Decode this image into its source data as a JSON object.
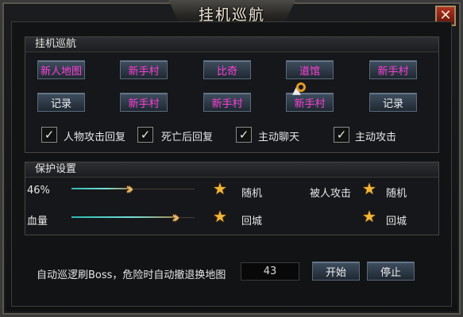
{
  "window": {
    "title": "挂机巡航",
    "close_glyph": "✕"
  },
  "patrol": {
    "title": "挂机巡航",
    "row1": [
      "新人地图",
      "新手村",
      "比奇",
      "道馆",
      "新手村"
    ],
    "row2": [
      "记录",
      "新手村",
      "新手村",
      "新手村",
      "记录"
    ],
    "checkboxes": [
      "人物攻击回复",
      "死亡后回复",
      "主动聊天",
      "主动攻击"
    ]
  },
  "protect": {
    "title": "保护设置",
    "hp_percent_label": "46%",
    "hp_percent_value": 46,
    "hp_label": "血量",
    "option1": "随机",
    "attacked_label": "被人攻击",
    "option2": "随机",
    "option3": "回城",
    "option4": "回城"
  },
  "boss": {
    "text": "自动巡逻刷Boss，危险时自动撤退换地图",
    "value": "43",
    "start": "开始",
    "stop": "停止"
  },
  "colors": {
    "accent_pink": "#ff3fd8",
    "star": "#f1b63a"
  }
}
